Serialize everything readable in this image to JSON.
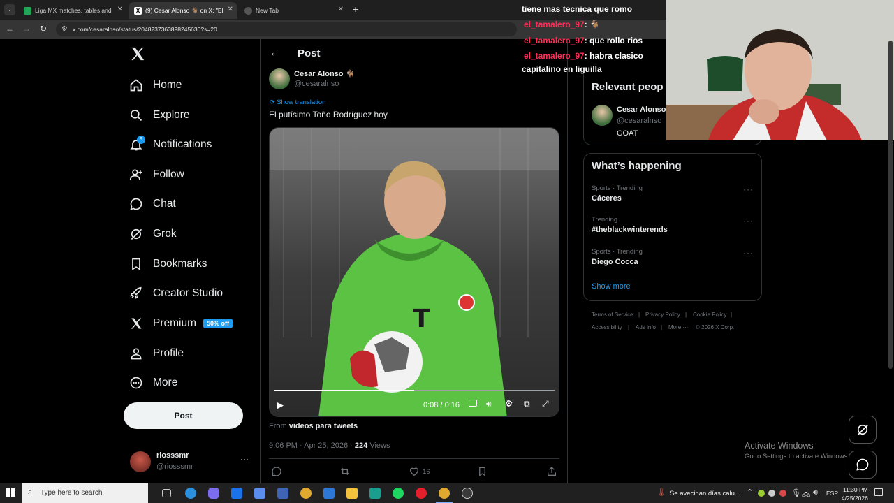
{
  "browser": {
    "tabs": [
      {
        "label": "Liga MX matches, tables and n…",
        "favicon_color": "#23a559"
      },
      {
        "label": "(9) Cesar Alonso 🐐 on X: \"El p…",
        "favicon_color": "#000000"
      },
      {
        "label": "New Tab",
        "favicon_color": "#444444"
      }
    ],
    "new_tab_label": "+",
    "url": "x.com/cesaralnso/status/2048237363898245630?s=20"
  },
  "nav": {
    "items": [
      {
        "label": "Home",
        "icon": "home-icon"
      },
      {
        "label": "Explore",
        "icon": "search-icon"
      },
      {
        "label": "Notifications",
        "icon": "bell-icon"
      },
      {
        "label": "Follow",
        "icon": "add-user-icon"
      },
      {
        "label": "Chat",
        "icon": "chat-icon"
      },
      {
        "label": "Grok",
        "icon": "grok-icon"
      },
      {
        "label": "Bookmarks",
        "icon": "bookmark-icon"
      },
      {
        "label": "Creator Studio",
        "icon": "rocket-icon"
      },
      {
        "label": "Premium",
        "icon": "x-icon"
      },
      {
        "label": "Profile",
        "icon": "person-icon"
      },
      {
        "label": "More",
        "icon": "more-circle-icon"
      }
    ],
    "notifications_count": "9",
    "premium_badge": "50% off",
    "post_button": "Post",
    "account": {
      "name": "riosssmr",
      "handle": "@riosssmr"
    }
  },
  "post": {
    "header_title": "Post",
    "author_name": "Cesar Alonso 🐐",
    "author_handle": "@cesaralnso",
    "show_translation": "Show translation",
    "text": "El putísimo Toño Rodríguez hoy",
    "video": {
      "time": "0:08 / 0:16",
      "progress": 0.5
    },
    "from_label": "From",
    "from_source": "videos para tweets",
    "timestamp": "9:06 PM · Apr 25, 2026 · ",
    "views_count": "224",
    "views_label": " Views",
    "likes": "16"
  },
  "sidebar": {
    "relevant_title": "Relevant peop",
    "relevant_person": {
      "name": "Cesar Alonso",
      "handle": "@cesaralnso",
      "bio": "GOAT"
    },
    "happening_title": "What’s happening",
    "trends": [
      {
        "meta": "Sports · Trending",
        "name": "Cáceres"
      },
      {
        "meta": "Trending",
        "name": "#theblackwinterends"
      },
      {
        "meta": "Sports · Trending",
        "name": "Diego Cocca"
      }
    ],
    "show_more": "Show more",
    "footer_links": [
      "Terms of Service",
      "|",
      "Privacy Policy",
      "|",
      "Cookie Policy",
      "|",
      "Accessibility",
      "|",
      "Ads info",
      "|",
      "More ···",
      "© 2026 X Corp."
    ]
  },
  "chat_overlay": [
    {
      "user": "",
      "message": "tiene mas tecnica que romo"
    },
    {
      "user": "el_tamalero_97",
      "message": ": 🐐"
    },
    {
      "user": "el_tamalero_97",
      "message": ": que rollo rios"
    },
    {
      "user": "el_tamalero_97",
      "message": ": habra clasico"
    },
    {
      "user": "",
      "message": "capitalino en liguilla"
    }
  ],
  "watermark": {
    "title": "Activate Windows",
    "subtitle": "Go to Settings to activate Windows."
  },
  "taskbar": {
    "search_placeholder": "Type here to search",
    "weather": "Se avecinan días calu…",
    "lang": "ESP",
    "time": "11:30 PM",
    "date": "4/25/2026"
  }
}
